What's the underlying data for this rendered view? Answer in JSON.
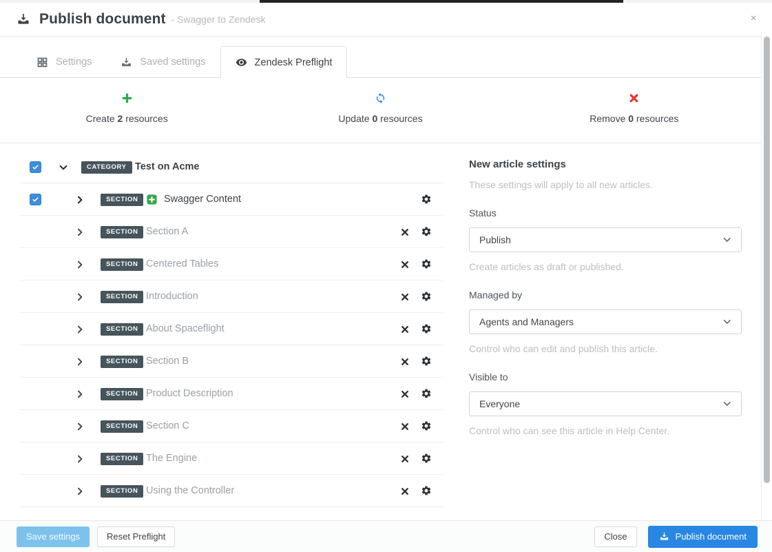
{
  "header": {
    "title": "Publish document",
    "subtitle": "- Swagger to Zendesk",
    "close": "×"
  },
  "tabs": [
    {
      "label": "Settings",
      "icon": "grid-icon",
      "active": false
    },
    {
      "label": "Saved settings",
      "icon": "save-tray-icon",
      "active": false
    },
    {
      "label": "Zendesk Preflight",
      "icon": "eye-icon",
      "active": true
    }
  ],
  "summary": [
    {
      "icon": "plus-icon",
      "prefix": "Create",
      "count": "2",
      "suffix": "resources"
    },
    {
      "icon": "sync-icon",
      "prefix": "Update",
      "count": "0",
      "suffix": "resources"
    },
    {
      "icon": "remove-x-icon",
      "prefix": "Remove",
      "count": "0",
      "suffix": "resources"
    }
  ],
  "tree": {
    "rows": [
      {
        "badge": "CATEGORY",
        "label": "Test on Acme",
        "level": "category",
        "checked": true,
        "expanded": true,
        "add_icon": false,
        "remove": false,
        "gear": false,
        "emphasis": "bold"
      },
      {
        "badge": "SECTION",
        "label": "Swagger Content",
        "level": "section",
        "checked": true,
        "expanded": false,
        "add_icon": true,
        "remove": false,
        "gear": true,
        "emphasis": "dark"
      },
      {
        "badge": "SECTION",
        "label": "Section A",
        "level": "section",
        "checked": false,
        "expanded": false,
        "add_icon": false,
        "remove": true,
        "gear": true,
        "emphasis": "normal"
      },
      {
        "badge": "SECTION",
        "label": "Centered Tables",
        "level": "section",
        "checked": false,
        "expanded": false,
        "add_icon": false,
        "remove": true,
        "gear": true,
        "emphasis": "normal"
      },
      {
        "badge": "SECTION",
        "label": "Introduction",
        "level": "section",
        "checked": false,
        "expanded": false,
        "add_icon": false,
        "remove": true,
        "gear": true,
        "emphasis": "normal"
      },
      {
        "badge": "SECTION",
        "label": "About Spaceflight",
        "level": "section",
        "checked": false,
        "expanded": false,
        "add_icon": false,
        "remove": true,
        "gear": true,
        "emphasis": "normal"
      },
      {
        "badge": "SECTION",
        "label": "Section B",
        "level": "section",
        "checked": false,
        "expanded": false,
        "add_icon": false,
        "remove": true,
        "gear": true,
        "emphasis": "normal"
      },
      {
        "badge": "SECTION",
        "label": "Product Description",
        "level": "section",
        "checked": false,
        "expanded": false,
        "add_icon": false,
        "remove": true,
        "gear": true,
        "emphasis": "normal"
      },
      {
        "badge": "SECTION",
        "label": "Section C",
        "level": "section",
        "checked": false,
        "expanded": false,
        "add_icon": false,
        "remove": true,
        "gear": true,
        "emphasis": "normal"
      },
      {
        "badge": "SECTION",
        "label": "The Engine",
        "level": "section",
        "checked": false,
        "expanded": false,
        "add_icon": false,
        "remove": true,
        "gear": true,
        "emphasis": "normal"
      },
      {
        "badge": "SECTION",
        "label": "Using the Controller",
        "level": "section",
        "checked": false,
        "expanded": false,
        "add_icon": false,
        "remove": true,
        "gear": true,
        "emphasis": "normal"
      }
    ]
  },
  "panel": {
    "title": "New article settings",
    "subtitle": "These settings will apply to all new articles.",
    "fields": [
      {
        "label": "Status",
        "value": "Publish",
        "help": "Create articles as draft or published."
      },
      {
        "label": "Managed by",
        "value": "Agents and Managers",
        "help": "Control who can edit and publish this article."
      },
      {
        "label": "Visible to",
        "value": "Everyone",
        "help": "Control who can see this article in Help Center."
      }
    ]
  },
  "footer": {
    "save": "Save settings",
    "reset": "Reset Preflight",
    "close": "Close",
    "publish": "Publish document"
  },
  "colors": {
    "accent_blue": "#2787e2",
    "light_blue": "#7cc2ed",
    "green": "#2fa84f",
    "red": "#e8342e",
    "badge_slate": "#46545c",
    "checkbox_blue": "#3d8edb"
  }
}
